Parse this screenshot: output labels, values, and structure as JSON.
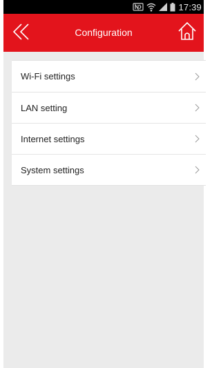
{
  "status_bar": {
    "time": "17:39",
    "icons": [
      "nfc-icon",
      "wifi-icon",
      "signal-icon",
      "battery-icon"
    ]
  },
  "header": {
    "title": "Configuration",
    "back_icon": "double-chevron-left-icon",
    "home_icon": "home-icon"
  },
  "menu": {
    "items": [
      {
        "label": "Wi-Fi settings"
      },
      {
        "label": "LAN setting"
      },
      {
        "label": "Internet settings"
      },
      {
        "label": "System settings"
      }
    ]
  },
  "colors": {
    "accent": "#e3141c",
    "background": "#ebebeb",
    "status_bar": "#000000"
  }
}
